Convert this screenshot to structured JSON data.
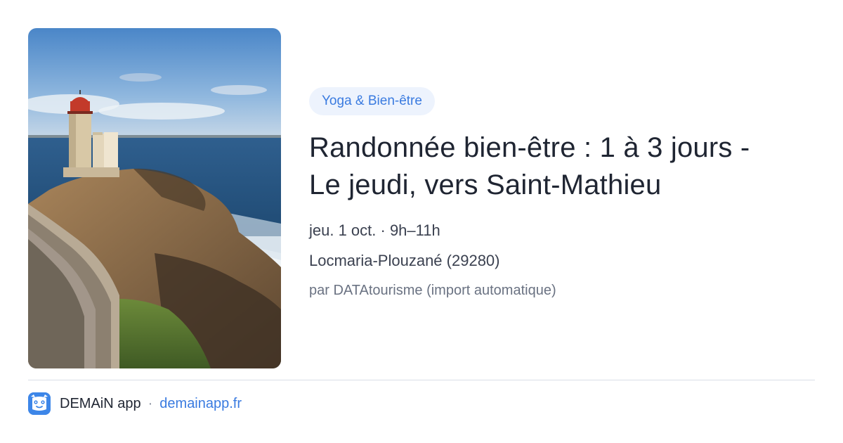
{
  "card": {
    "image_alt": "lighthouse-on-rocky-coast",
    "category": "Yoga & Bien-être",
    "title_line1": "Randonnée bien-être : 1 à 3 jours -",
    "title_line2": "Le jeudi, vers Saint-Mathieu",
    "date": "jeu. 1 oct. · 9h–11h",
    "location": "Locmaria-Plouzané (29280)",
    "source": "par DATAtourisme (import automatique)"
  },
  "footer": {
    "app_name": "DEMAiN app",
    "separator": "·",
    "link": "demainapp.fr"
  },
  "colors": {
    "accent": "#3a7be0",
    "tag_bg": "#edf3fd",
    "logo_bg": "#3d86e8"
  }
}
